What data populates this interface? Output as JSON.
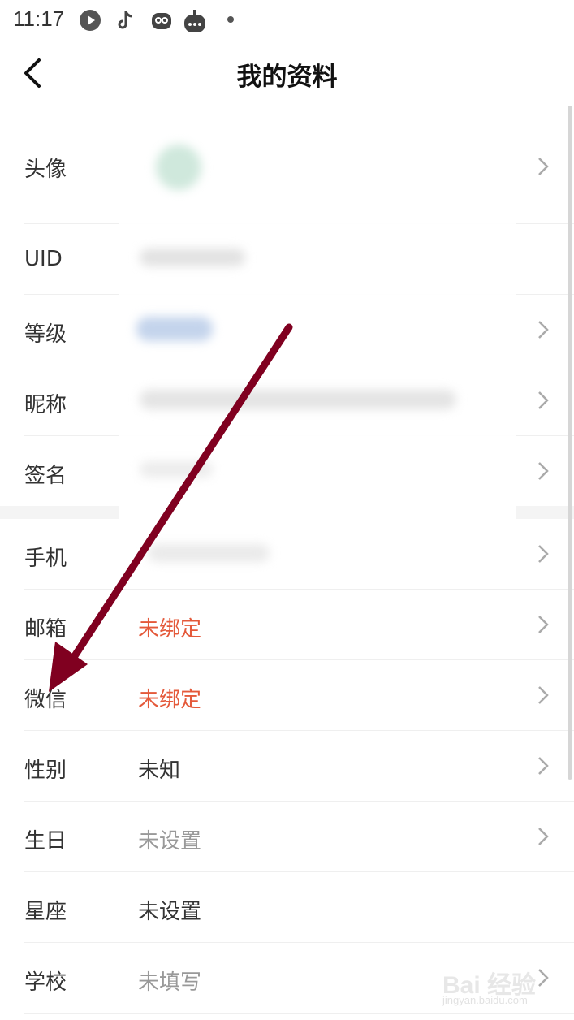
{
  "status_bar": {
    "time": "11:17",
    "icons": [
      "message-app-icon",
      "tiktok-icon",
      "owl-app-icon",
      "robot-app-icon",
      "notification-dot-icon"
    ]
  },
  "header": {
    "title": "我的资料",
    "back_icon": "chevron-left-icon"
  },
  "profile_rows": [
    {
      "label": "头像",
      "value": "",
      "value_style": "none",
      "has_chevron": true
    },
    {
      "label": "UID",
      "value": "",
      "value_style": "none",
      "has_chevron": false
    },
    {
      "label": "等级",
      "value": "",
      "value_style": "none",
      "has_chevron": true
    },
    {
      "label": "昵称",
      "value": "",
      "value_style": "none",
      "has_chevron": true
    },
    {
      "label": "签名",
      "value": "",
      "value_style": "none",
      "has_chevron": true
    }
  ],
  "account_rows": [
    {
      "label": "手机",
      "value": "",
      "value_style": "none",
      "has_chevron": true
    },
    {
      "label": "邮箱",
      "value": "未绑定",
      "value_style": "red",
      "has_chevron": true
    },
    {
      "label": "微信",
      "value": "未绑定",
      "value_style": "red",
      "has_chevron": true
    },
    {
      "label": "性别",
      "value": "未知",
      "value_style": "dark",
      "has_chevron": true
    },
    {
      "label": "生日",
      "value": "未设置",
      "value_style": "gray",
      "has_chevron": true
    },
    {
      "label": "星座",
      "value": "未设置",
      "value_style": "dark",
      "has_chevron": false
    },
    {
      "label": "学校",
      "value": "未填写",
      "value_style": "gray",
      "has_chevron": true
    }
  ],
  "colors": {
    "unbound_red": "#e4593a",
    "annotation_arrow": "#800020",
    "divider": "#efefef"
  },
  "watermark": {
    "text": "Bai 经验",
    "sub": "jingyan.baidu.com"
  }
}
